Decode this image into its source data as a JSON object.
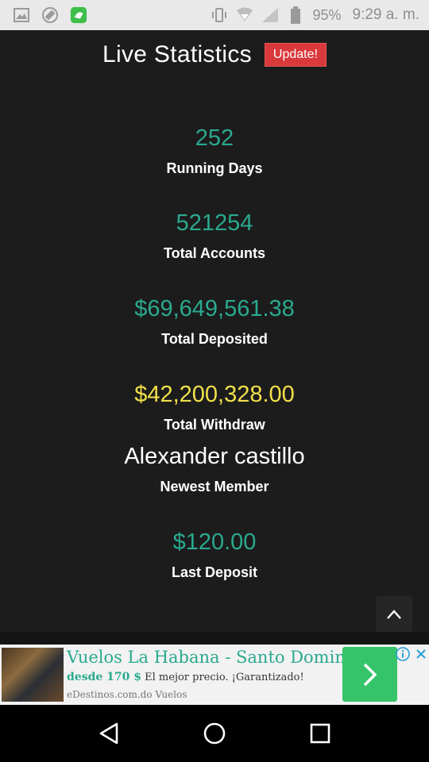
{
  "status_bar": {
    "battery_percent": "95%",
    "time": "9:29 a. m.",
    "icons": [
      "image-icon",
      "rotation-icon",
      "app-notification-icon",
      "vibrate-icon",
      "wifi-icon",
      "signal-icon",
      "battery-icon"
    ]
  },
  "header": {
    "title": "Live Statistics",
    "update_label": "Update!"
  },
  "stats": [
    {
      "value": "252",
      "label": "Running Days",
      "color": "#2aa98f"
    },
    {
      "value": "521254",
      "label": "Total Accounts",
      "color": "#2aa98f"
    },
    {
      "value": "$69,649,561.38",
      "label": "Total Deposited",
      "color": "#2aa98f"
    },
    {
      "value": "$42,200,328.00",
      "label": "Total Withdraw",
      "color": "#f1e04a"
    },
    {
      "value": "Alexander castillo",
      "label": "Newest Member",
      "color": "#ffffff"
    },
    {
      "value": "$120.00",
      "label": "Last Deposit",
      "color": "#2aa98f"
    }
  ],
  "ad": {
    "title": "Vuelos La Habana - Santo Domingo",
    "price": "desde 170 $",
    "tagline": "El mejor precio. ¡Garantizado!",
    "source": "eDestinos.com.do Vuelos"
  },
  "colors": {
    "background": "#1c1c1c",
    "accent_teal": "#2aa98f",
    "accent_yellow": "#f1e04a",
    "update_red": "#d9393b",
    "ad_green": "#35c46a"
  }
}
